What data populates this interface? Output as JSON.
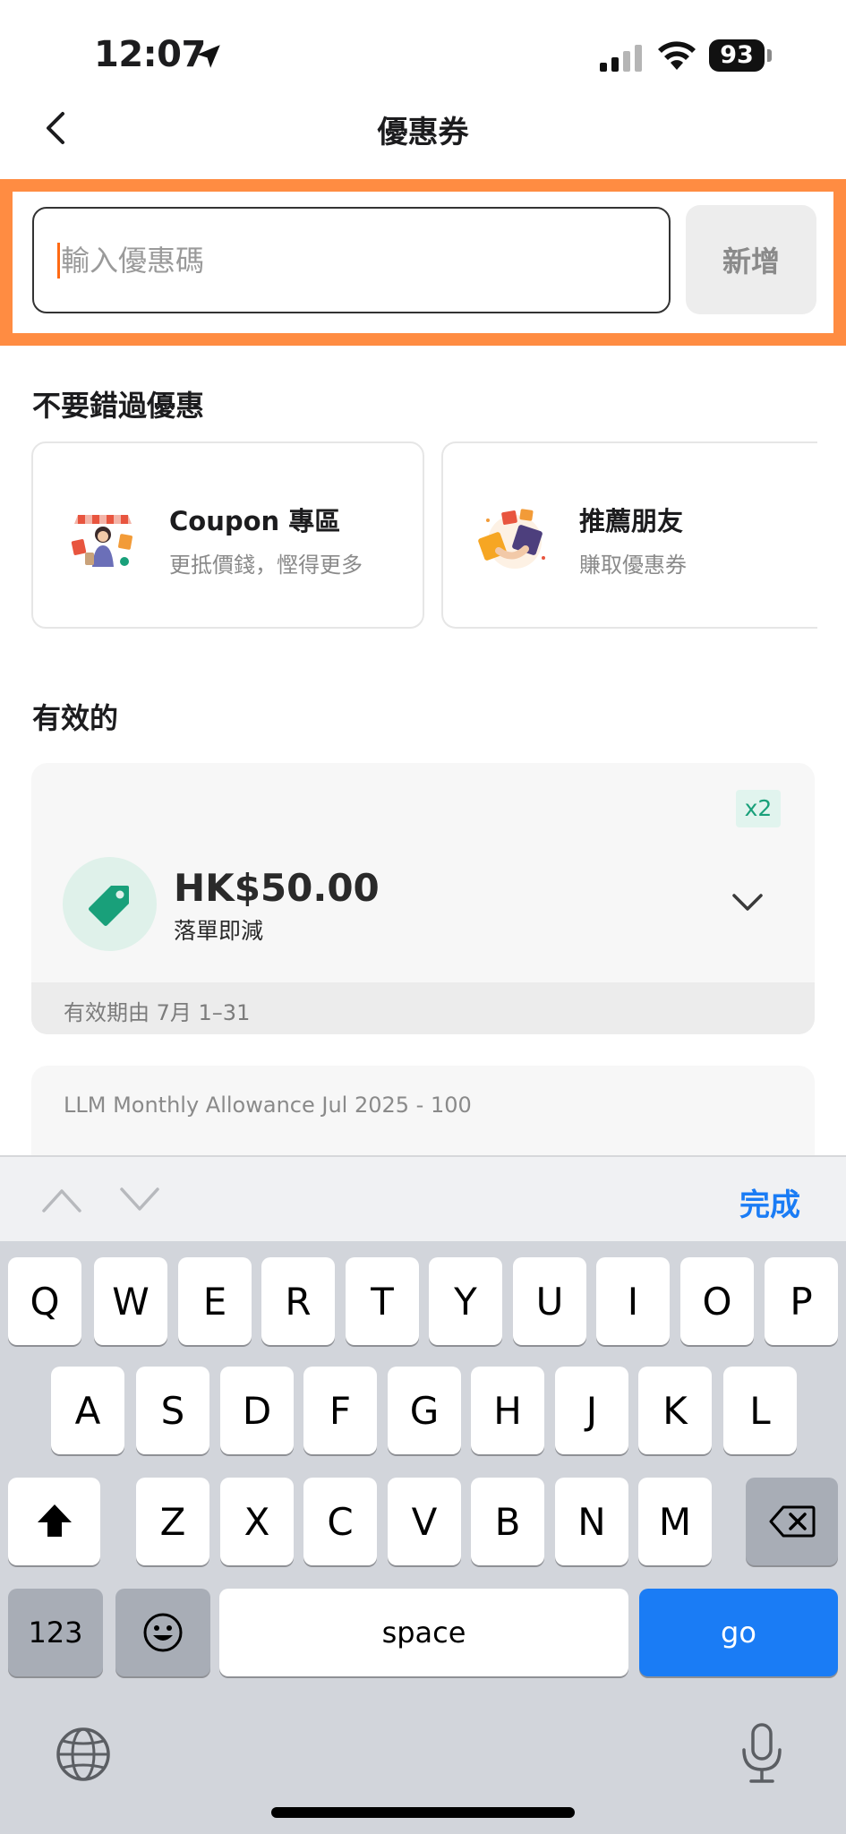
{
  "status_bar": {
    "time": "12:07",
    "battery": "93"
  },
  "nav": {
    "title": "優惠券"
  },
  "coupon_input": {
    "placeholder": "輸入優惠碼",
    "value": "",
    "add_label": "新增"
  },
  "promos": {
    "heading": "不要錯過優惠",
    "items": [
      {
        "title": "Coupon 專區",
        "subtitle": "更抵價錢，慳得更多",
        "icon": "shopping-woman-icon"
      },
      {
        "title": "推薦朋友",
        "subtitle": "賺取優惠券",
        "icon": "gift-box-icon"
      }
    ]
  },
  "valid": {
    "heading": "有效的",
    "coupons": [
      {
        "quantity": "x2",
        "amount": "HK$50.00",
        "description": "落單即減",
        "validity": "有效期由 7月 1–31"
      },
      {
        "name": "LLM Monthly Allowance Jul 2025 - 100"
      }
    ]
  },
  "keyboard_toolbar": {
    "done_label": "完成"
  },
  "keyboard": {
    "row1": [
      "Q",
      "W",
      "E",
      "R",
      "T",
      "Y",
      "U",
      "I",
      "O",
      "P"
    ],
    "row2": [
      "A",
      "S",
      "D",
      "F",
      "G",
      "H",
      "J",
      "K",
      "L"
    ],
    "row3": [
      "Z",
      "X",
      "C",
      "V",
      "B",
      "N",
      "M"
    ],
    "numbers_label": "123",
    "space_label": "space",
    "go_label": "go"
  },
  "colors": {
    "accent_highlight": "#ff8c42",
    "teal": "#19a07a",
    "ios_blue": "#1a7cf5"
  }
}
